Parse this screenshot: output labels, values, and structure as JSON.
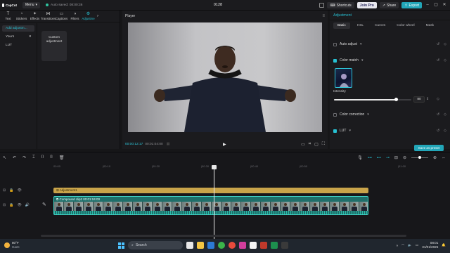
{
  "topbar": {
    "logo": "CapCut",
    "menu": "Menu",
    "autosave": "Auto saved: 08:00:36",
    "project": "0128",
    "shortcuts": "Shortcuts",
    "join_pro": "Join Pro",
    "share": "Share",
    "export": "Export"
  },
  "toolbar_tabs": [
    {
      "label": "Text",
      "icon": "text-icon"
    },
    {
      "label": "Stickers",
      "icon": "sticker-icon"
    },
    {
      "label": "Effects",
      "icon": "effects-icon"
    },
    {
      "label": "Transitions",
      "icon": "transitions-icon"
    },
    {
      "label": "Captions",
      "icon": "captions-icon"
    },
    {
      "label": "Filters",
      "icon": "filters-icon"
    },
    {
      "label": "Adjustme",
      "icon": "adjustment-icon"
    }
  ],
  "left_nav": {
    "add_adjustment": "Add adjustm...",
    "yours": "Yours",
    "lut": "LUT"
  },
  "custom_card": {
    "line1": "Custom",
    "line2": "adjustment"
  },
  "player": {
    "title": "Player",
    "timecode_current": "00:00:12:17",
    "timecode_total": "00:01:04:00"
  },
  "adjustment_panel": {
    "title": "Adjustment",
    "tabs": [
      "Basic",
      "HSL",
      "Curves",
      "Color wheel",
      "Mask"
    ],
    "auto_adjust": "Auto adjust",
    "color_match": "Color match",
    "intensity_label": "Intensity",
    "intensity_value": "80",
    "intensity_fraction": 0.8,
    "color_correction": "Color correction",
    "lut": "LUT",
    "save_preset": "Save as preset"
  },
  "timeline": {
    "ruler": [
      "00:00",
      "|00:10",
      "|00:20",
      "|00:30",
      "|00:40",
      "|00:50",
      "|01:00"
    ],
    "adjust_clip": "Adjustment1",
    "video_clip_name": "Compound clip2",
    "video_clip_duration": "00:01:04:00"
  },
  "taskbar": {
    "temp": "80°F",
    "weather": "Haze",
    "search": "Search",
    "time": "08:01",
    "date": "31/01/2025"
  }
}
